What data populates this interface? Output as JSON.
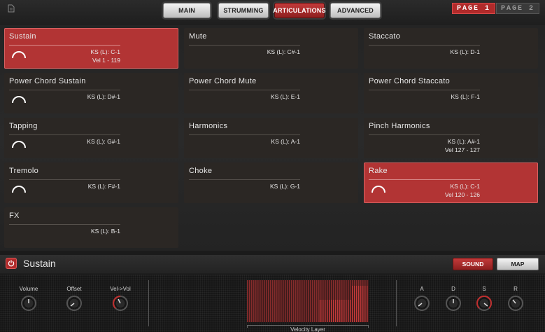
{
  "header": {
    "tabs": [
      {
        "label": "MAIN",
        "active": false
      },
      {
        "label": "STRUMMING",
        "active": false
      },
      {
        "label": "ARTICULATIONS",
        "active": true
      },
      {
        "label": "ADVANCED",
        "active": false
      }
    ],
    "pages": [
      {
        "label": "PAGE 1",
        "active": true
      },
      {
        "label": "PAGE 2",
        "active": false
      }
    ]
  },
  "articulations": [
    {
      "name": "Sustain",
      "ks": "KS (L): C-1",
      "vel": "Vel 1 - 119",
      "selected": true,
      "has_arc": true
    },
    {
      "name": "Mute",
      "ks": "KS (L): C#-1",
      "vel": "",
      "selected": false,
      "has_arc": false
    },
    {
      "name": "Staccato",
      "ks": "KS (L): D-1",
      "vel": "",
      "selected": false,
      "has_arc": false
    },
    {
      "name": "Power Chord Sustain",
      "ks": "KS (L): D#-1",
      "vel": "",
      "selected": false,
      "has_arc": true
    },
    {
      "name": "Power Chord Mute",
      "ks": "KS (L): E-1",
      "vel": "",
      "selected": false,
      "has_arc": false
    },
    {
      "name": "Power Chord Staccato",
      "ks": "KS (L): F-1",
      "vel": "",
      "selected": false,
      "has_arc": false
    },
    {
      "name": "Tapping",
      "ks": "KS (L): G#-1",
      "vel": "",
      "selected": false,
      "has_arc": true
    },
    {
      "name": "Harmonics",
      "ks": "KS (L): A-1",
      "vel": "",
      "selected": false,
      "has_arc": false
    },
    {
      "name": "Pinch Harmonics",
      "ks": "KS (L): A#-1",
      "vel": "Vel 127 - 127",
      "selected": false,
      "has_arc": false
    },
    {
      "name": "Tremolo",
      "ks": "KS (L): F#-1",
      "vel": "",
      "selected": false,
      "has_arc": true
    },
    {
      "name": "Choke",
      "ks": "KS (L): G-1",
      "vel": "",
      "selected": false,
      "has_arc": false
    },
    {
      "name": "Rake",
      "ks": "KS (L): C-1",
      "vel": "Vel 120 - 126",
      "selected": true,
      "has_arc": true
    },
    {
      "name": "FX",
      "ks": "KS (L): B-1",
      "vel": "",
      "selected": false,
      "has_arc": false
    }
  ],
  "bottom": {
    "title": "Sustain",
    "sound_label": "SOUND",
    "map_label": "MAP",
    "knobs_left": [
      {
        "label": "Volume",
        "active": false
      },
      {
        "label": "Offset",
        "active": false
      },
      {
        "label": "Vel->Vol",
        "active": true
      }
    ],
    "knobs_right": [
      {
        "label": "A",
        "active": false
      },
      {
        "label": "D",
        "active": false
      },
      {
        "label": "S",
        "active": true
      },
      {
        "label": "R",
        "active": false
      }
    ],
    "velocity_label": "Velocity Layer"
  },
  "colors": {
    "accent": "#b02a2a",
    "card_bg": "#2b2724",
    "background": "#1b1b1b"
  }
}
